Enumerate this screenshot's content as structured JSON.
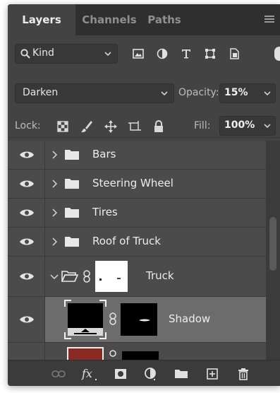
{
  "tabs": [
    {
      "label": "Layers",
      "active": true
    },
    {
      "label": "Channels",
      "active": false
    },
    {
      "label": "Paths",
      "active": false
    }
  ],
  "filter": {
    "kind_label": "Kind"
  },
  "blend": {
    "mode": "Darken",
    "opacity_label": "Opacity:",
    "opacity_value": "15%"
  },
  "lock": {
    "label": "Lock:",
    "fill_label": "Fill:",
    "fill_value": "100%"
  },
  "layers": [
    {
      "name": "Bars",
      "type": "group",
      "expanded": false,
      "visible": true
    },
    {
      "name": "Steering Wheel",
      "type": "group",
      "expanded": false,
      "visible": true
    },
    {
      "name": "Tires",
      "type": "group",
      "expanded": false,
      "visible": true
    },
    {
      "name": "Roof of Truck",
      "type": "group",
      "expanded": false,
      "visible": true
    },
    {
      "name": "Truck",
      "type": "group",
      "expanded": true,
      "visible": true,
      "has_mask": true
    },
    {
      "name": "Shadow",
      "type": "layer",
      "visible": true,
      "selected": true,
      "has_mask": true,
      "thumb_color": "#000000"
    },
    {
      "name": "",
      "type": "layer",
      "visible": true,
      "has_mask": true,
      "thumb_color": "#8b2a22"
    }
  ],
  "colors": {
    "panel": "#434343",
    "tabbar": "#2f2f2f",
    "selected_row": "#6c6c6c",
    "row": "#4b4b4b",
    "thumb_red": "#8b2a22"
  },
  "icons": {
    "filter": [
      "pixel-filter-icon",
      "adjustment-filter-icon",
      "type-filter-icon",
      "shape-filter-icon",
      "smart-object-filter-icon"
    ],
    "lock": [
      "lock-transparent-icon",
      "lock-image-icon",
      "lock-position-icon",
      "lock-artboard-icon",
      "lock-all-icon"
    ],
    "bottom": [
      "link-layers-icon",
      "fx-icon",
      "add-mask-icon",
      "adjustment-layer-icon",
      "new-group-icon",
      "new-layer-icon",
      "delete-icon"
    ]
  }
}
